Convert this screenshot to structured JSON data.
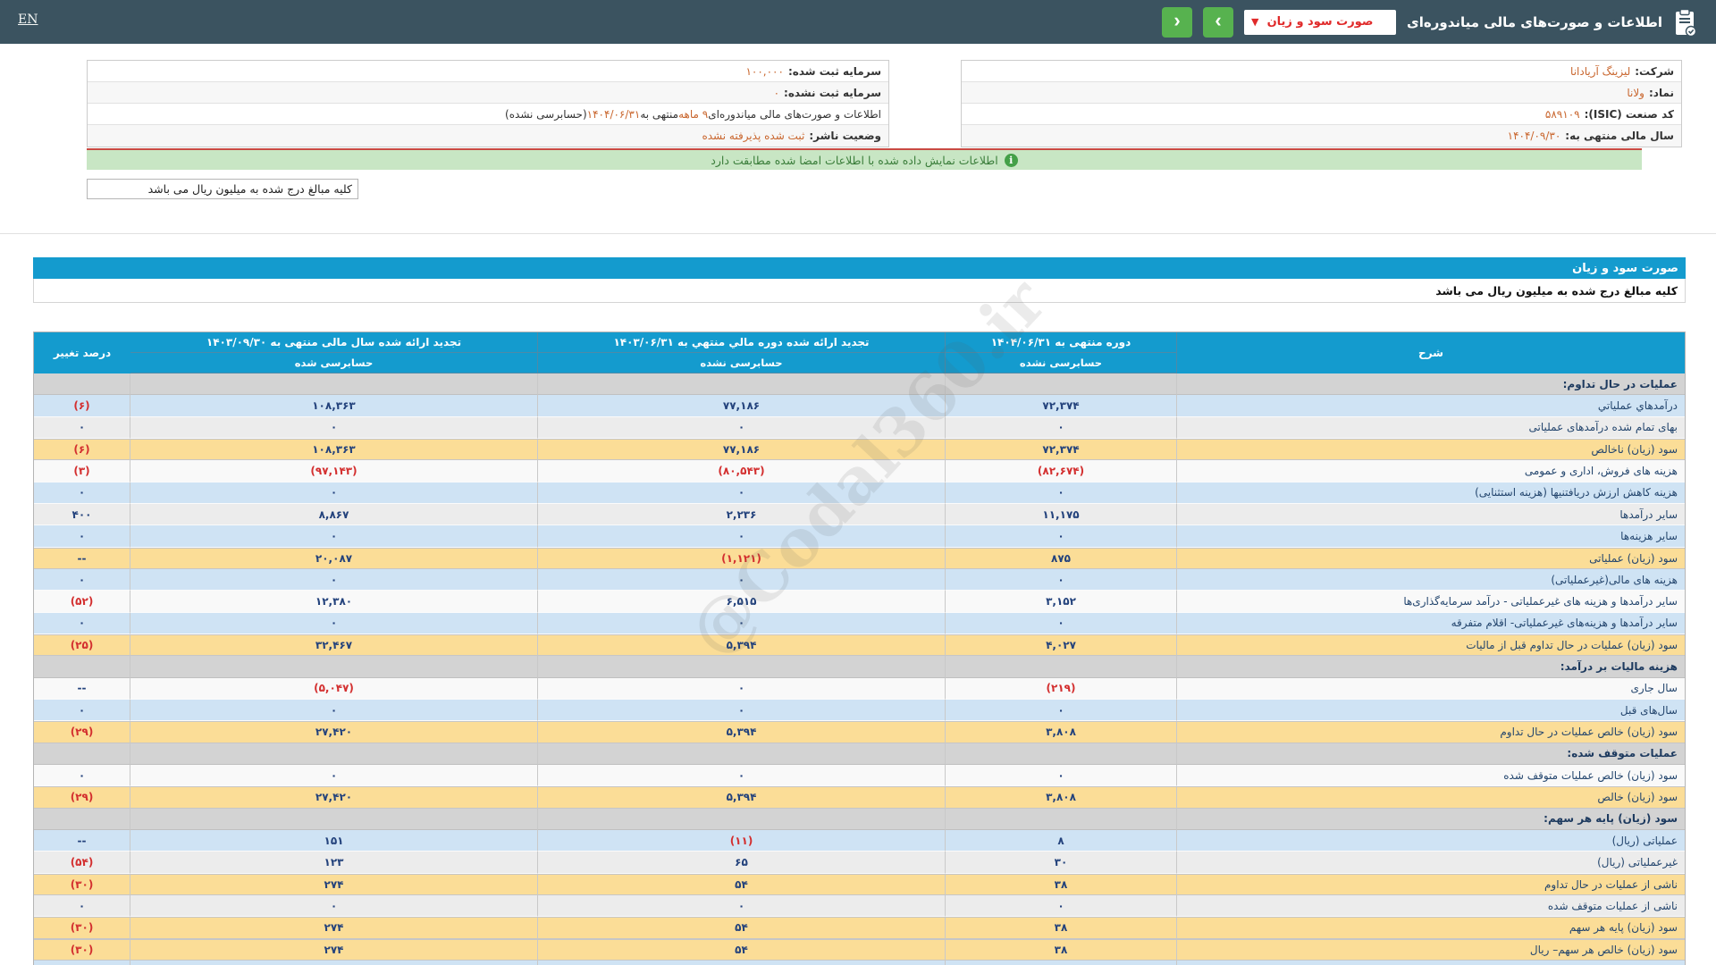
{
  "topbar": {
    "language_link": "EN",
    "title": "اطلاعات و صورت‌های مالی میاندوره‌ای",
    "report_select": {
      "value": "صورت سود و زیان",
      "caret": "▼"
    },
    "nav": {
      "next_label": "‹",
      "prev_label": "›"
    },
    "doc_icon": "clipboard-report-icon"
  },
  "company": {
    "right_rows": [
      {
        "label": "شرکت:",
        "value": "لیزینگ آریادانا"
      },
      {
        "label": "نماد:",
        "value": "ولانا"
      },
      {
        "label": "کد صنعت (ISIC):",
        "value": "۵۸۹۱۰۹"
      },
      {
        "label": "سال مالی منتهی به:",
        "value": "۱۴۰۴/۰۹/۳۰"
      }
    ],
    "left_rows": [
      {
        "label": "سرمایه ثبت شده:",
        "value": "۱۰۰,۰۰۰"
      },
      {
        "label": "سرمایه ثبت نشده:",
        "value": "۰"
      },
      {
        "segments": [
          {
            "t": "اطلاعات و صورت‌های مالی میاندوره‌ای ",
            "c": "dark"
          },
          {
            "t": "۹ ماهه",
            "c": "orange"
          },
          {
            "t": " منتهی به ",
            "c": "dark"
          },
          {
            "t": "۱۴۰۴/۰۶/۳۱",
            "c": "orange"
          },
          {
            "t": "(حسابرسی نشده)",
            "c": "dark"
          }
        ]
      },
      {
        "label": "وضعیت ناشر:",
        "value": "ثبت شده پذیرفته نشده"
      }
    ]
  },
  "banner": {
    "text": "اطلاعات نمایش داده شده با اطلاعات امضا شده مطابقت دارد",
    "icon_glyph": "i"
  },
  "amounts_note_box": "کلیه مبالغ درج شده به میلیون ریال می باشد",
  "statement": {
    "title": "صورت سود و زیان",
    "amounts_note": "کلیه مبالغ درج شده به میلیون ریال می باشد",
    "table": {
      "columns": [
        {
          "label": "شرح",
          "sub": null
        },
        {
          "label": "دوره منتهی به ۱۴۰۴/۰۶/۳۱",
          "sub": "حسابرسی نشده"
        },
        {
          "label": "تجدید ارائه شده دوره مالي منتهي به ۱۴۰۳/۰۶/۳۱",
          "sub": "حسابرسی نشده"
        },
        {
          "label": "تجدید ارائه شده سال مالی منتهی به ۱۴۰۳/۰۹/۳۰",
          "sub": "حسابرسی شده"
        },
        {
          "label": "درصد تغییر",
          "sub": null
        }
      ],
      "rows": [
        {
          "type": "section",
          "style": "section",
          "label": "عملیات در حال تداوم:"
        },
        {
          "type": "data",
          "style": "blue",
          "label": "درآمدهاي عملياتي",
          "values": [
            "۷۲,۳۷۴",
            "۷۷,۱۸۶",
            "۱۰۸,۳۶۳",
            "(۶)"
          ]
        },
        {
          "type": "data",
          "style": "gray",
          "label": "بهای تمام شده درآمدهای عملیاتی",
          "values": [
            "۰",
            "۰",
            "۰",
            "۰"
          ]
        },
        {
          "type": "data",
          "style": "yellow",
          "label": "سود (زیان) ناخالص",
          "values": [
            "۷۲,۳۷۴",
            "۷۷,۱۸۶",
            "۱۰۸,۳۶۳",
            "(۶)"
          ]
        },
        {
          "type": "data",
          "style": "white",
          "label": "هزینه های فروش، اداری و عمومی",
          "values": [
            "(۸۲,۶۷۴)",
            "(۸۰,۵۴۳)",
            "(۹۷,۱۴۳)",
            "(۳)"
          ]
        },
        {
          "type": "data",
          "style": "blue",
          "label": "هزینه کاهش ارزش دریافتنیها (هزینه استثنایی)",
          "values": [
            "۰",
            "۰",
            "۰",
            "۰"
          ]
        },
        {
          "type": "data",
          "style": "gray",
          "label": "سایر درآمدها",
          "values": [
            "۱۱,۱۷۵",
            "۲,۲۳۶",
            "۸,۸۶۷",
            "۴۰۰"
          ]
        },
        {
          "type": "data",
          "style": "blue",
          "label": "سایر هزینه‌ها",
          "values": [
            "۰",
            "۰",
            "۰",
            "۰"
          ]
        },
        {
          "type": "data",
          "style": "yellow",
          "label": "سود (زیان) عملیاتی",
          "values": [
            "۸۷۵",
            "(۱,۱۲۱)",
            "۲۰,۰۸۷",
            "--"
          ]
        },
        {
          "type": "data",
          "style": "blue",
          "label": "هزینه های مالی(غیرعملیاتی)",
          "values": [
            "۰",
            "۰",
            "۰",
            "۰"
          ]
        },
        {
          "type": "data",
          "style": "white",
          "label": "سایر درآمدها و هزینه های غیرعملیاتی - درآمد سرمایه‌گذاری‌ها",
          "values": [
            "۳,۱۵۲",
            "۶,۵۱۵",
            "۱۲,۳۸۰",
            "(۵۲)"
          ]
        },
        {
          "type": "data",
          "style": "blue",
          "label": "سایر درآمدها و هزینه‌های غیرعملیاتی- اقلام متفرقه",
          "values": [
            "۰",
            "۰",
            "۰",
            "۰"
          ]
        },
        {
          "type": "data",
          "style": "yellow",
          "label": "سود (زیان) عملیات در حال تداوم قبل از مالیات",
          "values": [
            "۴,۰۲۷",
            "۵,۳۹۴",
            "۳۲,۴۶۷",
            "(۲۵)"
          ]
        },
        {
          "type": "section",
          "style": "section",
          "label": "هزینه مالیات بر درآمد:"
        },
        {
          "type": "data",
          "style": "white",
          "label": "سال جاری",
          "values": [
            "(۲۱۹)",
            "۰",
            "(۵,۰۴۷)",
            "--"
          ]
        },
        {
          "type": "data",
          "style": "blue",
          "label": "سال‌های قبل",
          "values": [
            "۰",
            "۰",
            "۰",
            "۰"
          ]
        },
        {
          "type": "data",
          "style": "yellow",
          "label": "سود (زیان) خالص عملیات در حال تداوم",
          "values": [
            "۳,۸۰۸",
            "۵,۳۹۴",
            "۲۷,۴۲۰",
            "(۲۹)"
          ]
        },
        {
          "type": "section",
          "style": "section",
          "label": "عملیات متوقف شده:"
        },
        {
          "type": "data",
          "style": "white",
          "label": "سود (زیان) خالص عملیات متوقف شده",
          "values": [
            "۰",
            "۰",
            "۰",
            "۰"
          ]
        },
        {
          "type": "data",
          "style": "yellow",
          "label": "سود (زیان) خالص",
          "values": [
            "۳,۸۰۸",
            "۵,۳۹۴",
            "۲۷,۴۲۰",
            "(۲۹)"
          ]
        },
        {
          "type": "section",
          "style": "section",
          "label": "سود (زیان) پایه هر سهم:"
        },
        {
          "type": "data",
          "style": "blue",
          "label": "عملیاتی (ریال)",
          "values": [
            "۸",
            "(۱۱)",
            "۱۵۱",
            "--"
          ]
        },
        {
          "type": "data",
          "style": "gray",
          "label": "غیرعملیاتی (ریال)",
          "values": [
            "۳۰",
            "۶۵",
            "۱۲۳",
            "(۵۴)"
          ]
        },
        {
          "type": "data",
          "style": "yellow",
          "label": "ناشی از عملیات در حال تداوم",
          "values": [
            "۳۸",
            "۵۴",
            "۲۷۴",
            "(۳۰)"
          ]
        },
        {
          "type": "data",
          "style": "gray",
          "label": "ناشی از عملیات متوقف شده",
          "values": [
            "۰",
            "۰",
            "۰",
            "۰"
          ]
        },
        {
          "type": "data",
          "style": "yellow",
          "label": "سود (زیان) پایه هر سهم",
          "values": [
            "۳۸",
            "۵۴",
            "۲۷۴",
            "(۳۰)"
          ]
        },
        {
          "type": "data",
          "style": "yellow",
          "label": "سود (زیان) خالص هر سهم– ریال",
          "values": [
            "۳۸",
            "۵۴",
            "۲۷۴",
            "(۳۰)"
          ]
        },
        {
          "type": "partial",
          "style": "partial",
          "label": ""
        }
      ]
    }
  },
  "watermark": "@Codal360.ir",
  "colors": {
    "topbar_bg": "#3b5360",
    "table_header_bg": "#149bce",
    "row_blue": "#cfe3f4",
    "row_yellow": "#fbdd97",
    "row_section": "#d3d3d3",
    "negative_red": "#d32f2f",
    "value_navy": "#23427c",
    "orange_value": "#c9662e",
    "banner_green_bg": "#c8e6c4",
    "nav_button_green": "#57b24f",
    "select_text_red": "#e02a2a"
  }
}
